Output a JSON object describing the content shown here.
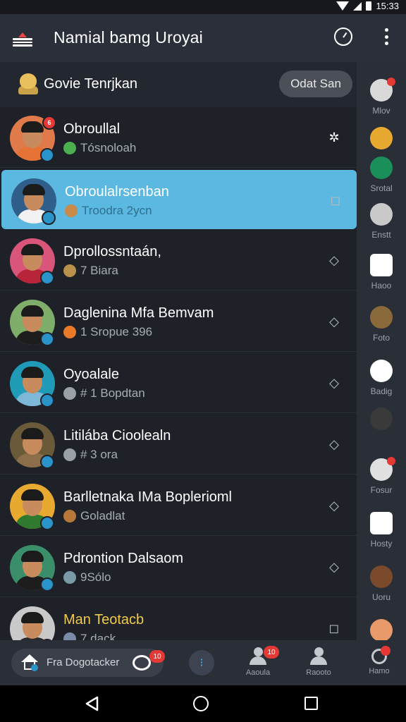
{
  "status_bar": {
    "time": "15:33"
  },
  "app_bar": {
    "title": "Namial bamg Uroyai"
  },
  "section": {
    "title": "Govie Tenrjkan",
    "button_label": "Odat San"
  },
  "contacts": [
    {
      "name": "Obroullal",
      "sub": "Tósnoloah",
      "top_badge": "6",
      "action": "gear"
    },
    {
      "name": "Obroulalrsenban",
      "sub": "Troodra 2ycn",
      "top_badge": "",
      "action": "square",
      "selected": true
    },
    {
      "name": "Dprollossntaán,",
      "sub": "7 Biara",
      "top_badge": "",
      "action": "diamond"
    },
    {
      "name": "Daglenina Mfa Bemvam",
      "sub": "1 Sropue 396",
      "top_badge": "",
      "action": "diamond"
    },
    {
      "name": "Oyoalale",
      "sub": "# 1 Bopdtan",
      "top_badge": "",
      "action": "diamond"
    },
    {
      "name": "Litilába Cioolealn",
      "sub": "# 3 ora",
      "top_badge": "",
      "action": "diamond"
    },
    {
      "name": "Barlletnaka IMa Boplerioml",
      "sub": "Goladlat",
      "top_badge": "",
      "action": "diamond"
    },
    {
      "name": "Pdrontion Dalsaom",
      "sub": "9Sólo",
      "top_badge": "",
      "action": "diamond"
    },
    {
      "name": "Man Teotacb",
      "sub": "7 dack",
      "top_badge": "",
      "action": "square"
    }
  ],
  "rail": [
    {
      "label": "Mlov",
      "icon": "avatar-icon"
    },
    {
      "label": "",
      "icon": "crown-icon"
    },
    {
      "label": "Srotal",
      "icon": "share-icon"
    },
    {
      "label": "Enstt",
      "icon": "chat-icon"
    },
    {
      "label": "Haoo",
      "icon": "pause-icon"
    },
    {
      "label": "Foto",
      "icon": "hammer-icon"
    },
    {
      "label": "Badig",
      "icon": "record-icon"
    },
    {
      "label": "",
      "icon": "avatar-icon"
    },
    {
      "label": "Fosur",
      "icon": "box-icon"
    },
    {
      "label": "Hosty",
      "icon": "camera-icon"
    },
    {
      "label": "Uoru",
      "icon": "tool-icon"
    },
    {
      "label": "",
      "icon": "avatar-icon"
    }
  ],
  "bottom_bar": {
    "search_text": "Fra Dogotacker",
    "eye_badge": "10",
    "people_badge": "10",
    "search_badge": "",
    "nav": [
      {
        "label": "Aaoula"
      },
      {
        "label": "Raooto"
      },
      {
        "label": "Hamo"
      }
    ]
  },
  "colors": {
    "background": "#1e2128",
    "selected_row": "#5bb8e0",
    "accent_red": "#e53935",
    "accent_blue": "#2a93c9"
  }
}
